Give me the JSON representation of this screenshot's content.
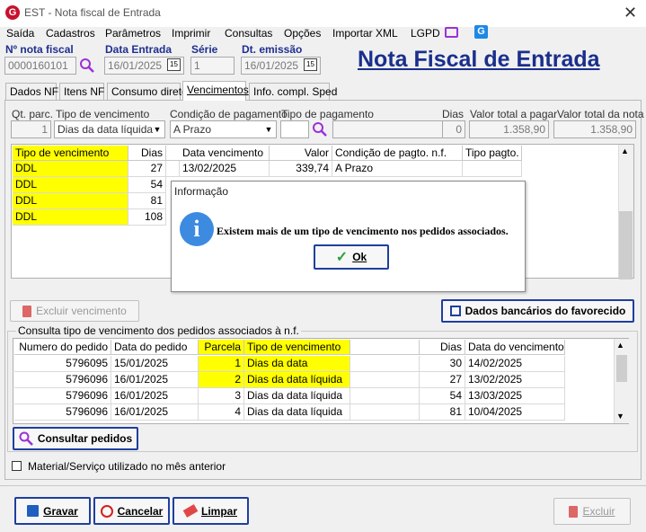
{
  "window": {
    "title": "EST - Nota fiscal de Entrada",
    "close_glyph": "✕"
  },
  "menu": [
    "Saída",
    "Cadastros",
    "Parâmetros",
    "Imprimir",
    "Consultas",
    "Opções",
    "Importar XML",
    "LGPD"
  ],
  "header": {
    "nota_label": "Nº nota fiscal",
    "nota_value": "0000160101",
    "data_entrada_label": "Data Entrada",
    "data_entrada_value": "16/01/2025",
    "serie_label": "Série",
    "serie_value": "1",
    "dt_emissao_label": "Dt. emissão",
    "dt_emissao_value": "16/01/2025",
    "calendar_glyph": "15",
    "big_title": "Nota Fiscal de Entrada"
  },
  "tabs": [
    "Dados NF",
    "Itens NF",
    "Consumo direto",
    "Vencimentos",
    "Info. compl. Sped"
  ],
  "vencimentos": {
    "qt_parc_label": "Qt. parc.",
    "qt_parc_value": "1",
    "tipo_venc_label": "Tipo de vencimento",
    "tipo_venc_value": "Dias da data líquida",
    "cond_pag_label": "Condição de pagamento",
    "cond_pag_value": "A Prazo",
    "tipo_pag_label": "Tipo de pagamento",
    "tipo_pag_value": "",
    "dias_label": "Dias",
    "dias_value": "0",
    "valor_pagar_label": "Valor total a pagar",
    "valor_pagar_value": "1.358,90",
    "valor_nota_label": "Valor total da nota",
    "valor_nota_value": "1.358,90"
  },
  "grid1": {
    "headers": [
      "Tipo de vencimento",
      "Dias",
      "Data vencimento",
      "Valor",
      "Condição de pagto. n.f.",
      "Tipo pagto."
    ],
    "rows": [
      [
        "DDL",
        "27",
        "13/02/2025",
        "339,74",
        "A Prazo",
        ""
      ],
      [
        "DDL",
        "54",
        "",
        "",
        "",
        ""
      ],
      [
        "DDL",
        "81",
        "",
        "",
        "",
        ""
      ],
      [
        "DDL",
        "108",
        "",
        "",
        "",
        ""
      ]
    ]
  },
  "dialog": {
    "title": "Informação",
    "icon_glyph": "i",
    "message": "Existem mais de um tipo de vencimento nos pedidos associados.",
    "ok_label": "Ok"
  },
  "buttons": {
    "excluir_vencimento": "Excluir vencimento",
    "dados_bancarios": "Dados bancários do favorecido",
    "consultar_pedidos": "Consultar pedidos",
    "gravar": "Gravar",
    "cancelar": "Cancelar",
    "limpar": "Limpar",
    "excluir": "Excluir"
  },
  "consulta": {
    "title": "Consulta tipo de vencimento dos pedidos associados à n.f.",
    "headers": [
      "Numero do pedido",
      "Data do pedido",
      "Parcela",
      "Tipo de vencimento",
      "Dias",
      "Data do vencimento"
    ],
    "rows": [
      [
        "5796095",
        "15/01/2025",
        "1",
        "Dias da data",
        "30",
        "14/02/2025"
      ],
      [
        "5796096",
        "16/01/2025",
        "2",
        "Dias da data líquida",
        "27",
        "13/02/2025"
      ],
      [
        "5796096",
        "16/01/2025",
        "3",
        "Dias da data líquida",
        "54",
        "13/03/2025"
      ],
      [
        "5796096",
        "16/01/2025",
        "4",
        "Dias da data líquida",
        "81",
        "10/04/2025"
      ]
    ]
  },
  "checkbox": {
    "label": "Material/Serviço utilizado no mês anterior",
    "checked": false
  },
  "colors": {
    "accent": "#1a2f8c",
    "highlight": "#ffff00",
    "brand_red": "#c8102e"
  }
}
